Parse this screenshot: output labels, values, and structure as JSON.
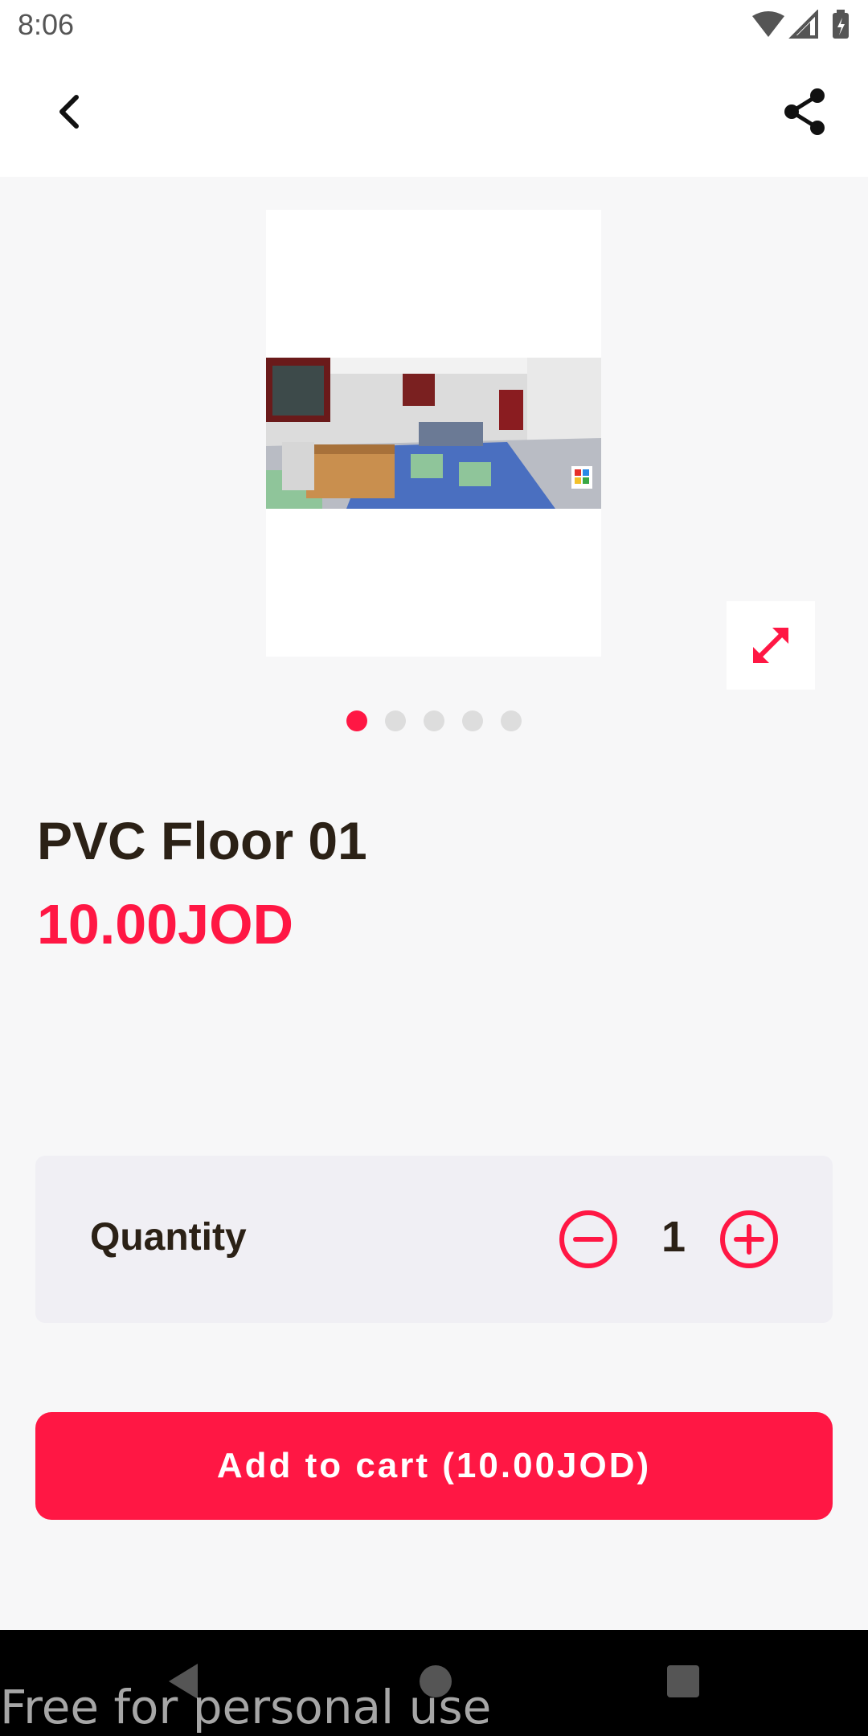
{
  "status_bar": {
    "time": "8:06",
    "icons": [
      "wifi-icon",
      "signal-icon",
      "battery-icon"
    ]
  },
  "toolbar": {
    "back_icon": "back-arrow-icon",
    "share_icon": "share-icon"
  },
  "gallery": {
    "image_description_icon": "product-photo",
    "expand_icon": "expand-icon",
    "page_count": 5,
    "active_page": 1
  },
  "product": {
    "title": "PVC Floor 01",
    "price": "10.00JOD"
  },
  "quantity": {
    "label": "Quantity",
    "value": "1",
    "decrease_icon": "minus-circle-icon",
    "increase_icon": "plus-circle-icon"
  },
  "cart": {
    "button_label": "Add to cart (10.00JOD)"
  },
  "nav": {
    "icons": [
      "nav-back-icon",
      "nav-home-icon",
      "nav-recents-icon"
    ]
  },
  "watermark": "Free for personal use",
  "colors": {
    "accent": "#ff1744",
    "text": "#2b2116",
    "background": "#f7f7f8",
    "card": "#f0eff4"
  }
}
